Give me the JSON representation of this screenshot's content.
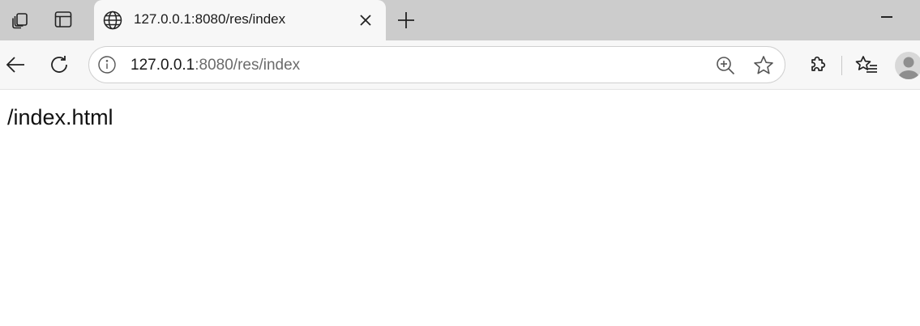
{
  "tab": {
    "title": "127.0.0.1:8080/res/index"
  },
  "address_bar": {
    "host": "127.0.0.1",
    "rest": ":8080/res/index"
  },
  "page": {
    "text": "/index.html"
  },
  "icons": {
    "workspaces": "workspaces-icon",
    "tab_actions": "tab-actions-icon",
    "favicon": "globe-icon",
    "close_tab": "close-icon",
    "new_tab": "plus-icon",
    "minimize": "minimize-icon",
    "back": "back-arrow-icon",
    "refresh": "refresh-icon",
    "site_info": "info-icon",
    "zoom": "zoom-in-icon",
    "favorite": "star-icon",
    "extensions": "puzzle-icon",
    "favorites": "favorites-list-icon",
    "profile": "avatar-icon"
  },
  "colors": {
    "tabstrip": "#cccccc",
    "toolbar": "#f7f7f7",
    "url_host": "#1a1a1a",
    "url_rest": "#6b6b6b"
  }
}
